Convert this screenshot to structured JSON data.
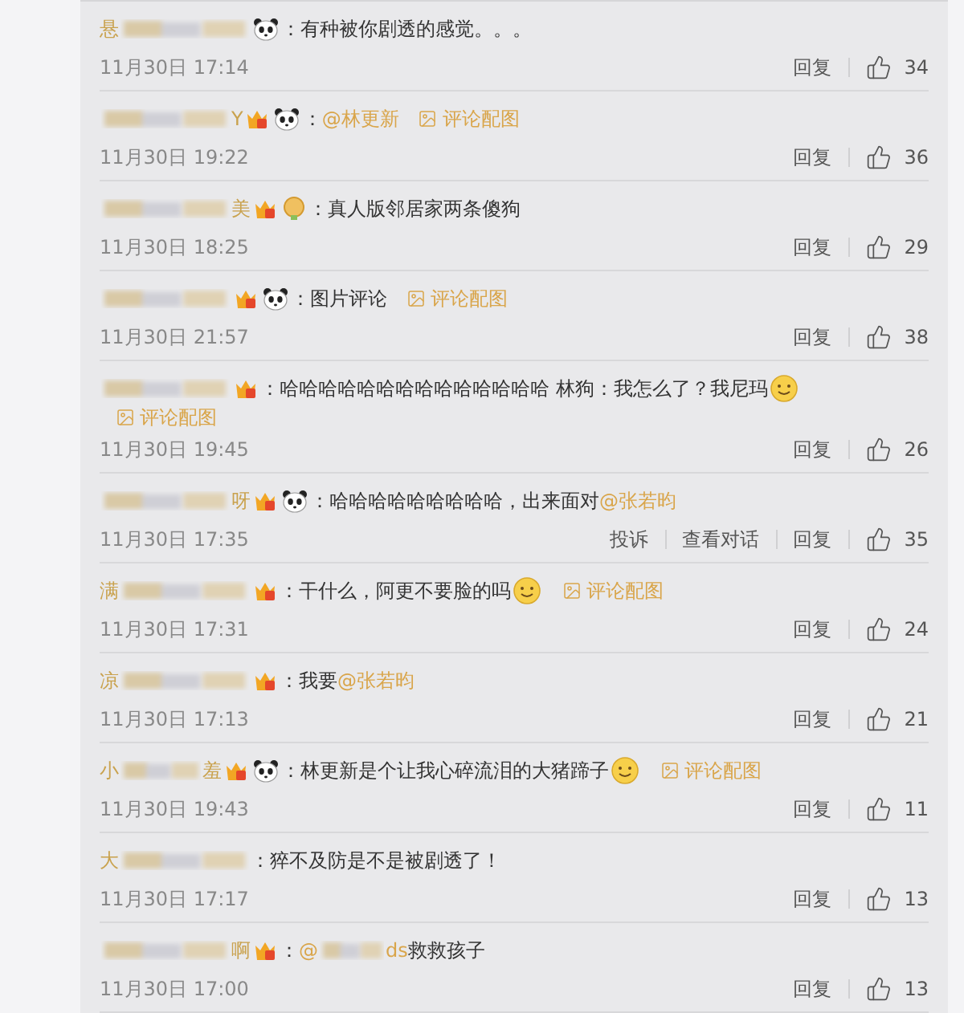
{
  "comments": [
    {
      "name_head": "悬",
      "badges": [
        {
          "kind": "panda"
        }
      ],
      "colon": "：",
      "content": [
        {
          "kind": "text",
          "text": "有种被你剧透的感觉。。。"
        }
      ],
      "time": "11月30日 17:14",
      "actions": [
        "回复"
      ],
      "likes": "34"
    },
    {
      "name_tail": "Y",
      "badges": [
        {
          "kind": "vip"
        },
        {
          "kind": "panda"
        }
      ],
      "colon": "：",
      "content": [
        {
          "kind": "mention",
          "text": "@林更新"
        }
      ],
      "image_link": "评论配图",
      "time": "11月30日 19:22",
      "actions": [
        "回复"
      ],
      "likes": "36"
    },
    {
      "name_tail": "美",
      "badges": [
        {
          "kind": "vip"
        },
        {
          "kind": "medal"
        }
      ],
      "colon": "：",
      "content": [
        {
          "kind": "text",
          "text": "真人版邻居家两条傻狗"
        }
      ],
      "time": "11月30日 18:25",
      "actions": [
        "回复"
      ],
      "likes": "29"
    },
    {
      "badges": [
        {
          "kind": "vip"
        },
        {
          "kind": "panda"
        }
      ],
      "colon": "：",
      "content": [
        {
          "kind": "text",
          "text": "图片评论"
        }
      ],
      "image_link": "评论配图",
      "time": "11月30日 21:57",
      "actions": [
        "回复"
      ],
      "likes": "38"
    },
    {
      "badges": [
        {
          "kind": "vip"
        }
      ],
      "colon": "：",
      "content": [
        {
          "kind": "text",
          "text": "哈哈哈哈哈哈哈哈哈哈哈哈哈哈 林狗：我怎么了？我尼玛"
        },
        {
          "kind": "emoji"
        }
      ],
      "image_link": "评论配图",
      "break_link": true,
      "time": "11月30日 19:45",
      "actions": [
        "回复"
      ],
      "likes": "26"
    },
    {
      "name_tail": "呀",
      "badges": [
        {
          "kind": "vip"
        },
        {
          "kind": "panda"
        }
      ],
      "colon": "：",
      "content": [
        {
          "kind": "text",
          "text": "哈哈哈哈哈哈哈哈哈，出来面对"
        },
        {
          "kind": "mention",
          "text": "@张若昀"
        }
      ],
      "time": "11月30日 17:35",
      "actions": [
        "投诉",
        "查看对话",
        "回复"
      ],
      "likes": "35"
    },
    {
      "name_head": "满",
      "badges": [
        {
          "kind": "vip"
        }
      ],
      "colon": "：",
      "content": [
        {
          "kind": "text",
          "text": "干什么，阿更不要脸的吗"
        },
        {
          "kind": "emoji"
        }
      ],
      "image_link": "评论配图",
      "time": "11月30日 17:31",
      "actions": [
        "回复"
      ],
      "likes": "24"
    },
    {
      "name_head": "凉",
      "badges": [
        {
          "kind": "vip"
        }
      ],
      "colon": "：",
      "content": [
        {
          "kind": "text",
          "text": "我要"
        },
        {
          "kind": "mention",
          "text": "@张若昀"
        }
      ],
      "time": "11月30日 17:13",
      "actions": [
        "回复"
      ],
      "likes": "21"
    },
    {
      "name_head": "小",
      "name_tail": "羞",
      "badges": [
        {
          "kind": "vip"
        },
        {
          "kind": "panda"
        }
      ],
      "colon": "：",
      "content": [
        {
          "kind": "text",
          "text": "林更新是个让我心碎流泪的大猪蹄子"
        },
        {
          "kind": "emoji"
        }
      ],
      "image_link": "评论配图",
      "time": "11月30日 19:43",
      "actions": [
        "回复"
      ],
      "likes": "11"
    },
    {
      "name_head": "大",
      "colon": "：",
      "content": [
        {
          "kind": "text",
          "text": "猝不及防是不是被剧透了！"
        }
      ],
      "time": "11月30日 17:17",
      "actions": [
        "回复"
      ],
      "likes": "13"
    },
    {
      "name_tail": "啊",
      "badges": [
        {
          "kind": "vip"
        }
      ],
      "colon": "：",
      "content": [
        {
          "kind": "mention",
          "text": "@"
        },
        {
          "kind": "blur"
        },
        {
          "kind": "mention",
          "text": "ds"
        },
        {
          "kind": "text",
          "text": " 救救孩子"
        }
      ],
      "time": "11月30日 17:00",
      "actions": [
        "回复"
      ],
      "likes": "13"
    }
  ]
}
